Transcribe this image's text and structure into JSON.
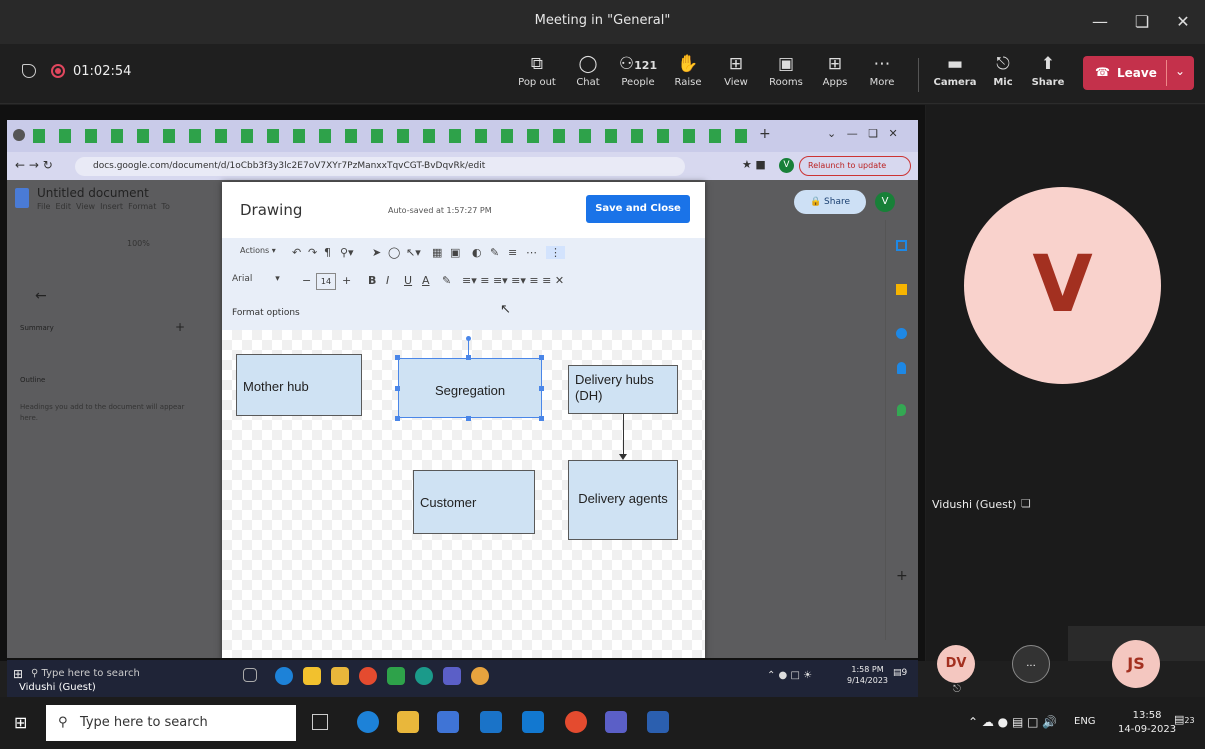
{
  "window": {
    "title": "Meeting in \"General\""
  },
  "meeting": {
    "timer": "01:02:54",
    "controls": [
      {
        "label": "Pop out",
        "icon": "pop-out-icon"
      },
      {
        "label": "Chat",
        "icon": "chat-icon"
      },
      {
        "label": "People",
        "icon": "people-icon",
        "count": "121"
      },
      {
        "label": "Raise",
        "icon": "raise-hand-icon"
      },
      {
        "label": "View",
        "icon": "view-icon"
      },
      {
        "label": "Rooms",
        "icon": "rooms-icon"
      },
      {
        "label": "Apps",
        "icon": "apps-icon"
      },
      {
        "label": "More",
        "icon": "more-icon"
      },
      {
        "label": "Camera",
        "icon": "camera-off-icon"
      },
      {
        "label": "Mic",
        "icon": "mic-off-icon"
      },
      {
        "label": "Share",
        "icon": "share-icon"
      }
    ],
    "leave_label": "Leave",
    "participant_name": "Vidushi (Guest)",
    "avatar_letter": "V",
    "presenter_label": "Vidushi (Guest)",
    "tiles": [
      {
        "initials": "DV"
      },
      {
        "initials": "..."
      },
      {
        "initials": "JS"
      }
    ]
  },
  "browser": {
    "url": "docs.google.com/document/d/1oCbb3f3y3lc2E7oV7XYr7PzManxxTqvCGT-BvDqvRk/edit",
    "relaunch_label": "Relaunch to update",
    "profile_letter": "V"
  },
  "doc": {
    "title": "Untitled document",
    "menu": "File  Edit  View  Insert  Format  To",
    "zoom": "100%",
    "summary_label": "Summary",
    "outline_label": "Outline",
    "outline_hint": "Headings you add to the document will appear here.",
    "share_label": "Share"
  },
  "drawing": {
    "title": "Drawing",
    "autosave": "Auto-saved at 1:57:27 PM",
    "save_close": "Save and Close",
    "actions_label": "Actions",
    "font": "Arial",
    "font_size": "14",
    "format_options": "Format options",
    "boxes": {
      "mother_hub": "Mother hub",
      "segregation": "Segregation",
      "delivery_hubs": "Delivery hubs (DH)",
      "customer": "Customer",
      "delivery_agents": "Delivery agents"
    }
  },
  "inner_taskbar": {
    "search": "Type here to search",
    "time": "1:58 PM",
    "date": "9/14/2023",
    "notif": "9"
  },
  "taskbar": {
    "search": "Type here to search",
    "lang": "ENG",
    "time": "13:58",
    "date": "14-09-2023",
    "notif": "23"
  }
}
